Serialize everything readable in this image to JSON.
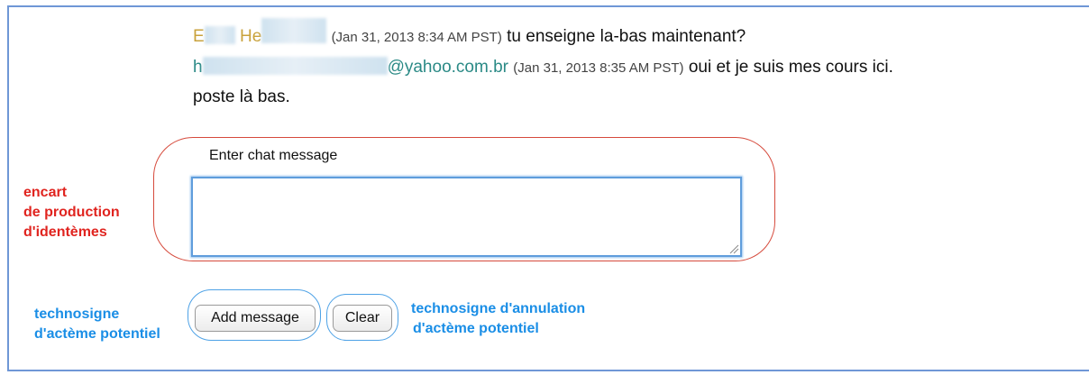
{
  "messages": [
    {
      "sender_visible_start": "E",
      "sender_visible_mid": "H",
      "sender_visible_end": "e",
      "timestamp": "(Jan 31, 2013 8:34 AM PST)",
      "text": "tu enseigne la-bas maintenant?"
    },
    {
      "sender_visible_start": "h",
      "sender_visible_end": "@yahoo.com.br",
      "timestamp": "(Jan 31, 2013 8:35 AM PST)",
      "text": "oui et je suis mes cours ici.",
      "text_continued": "poste là bas."
    }
  ],
  "chat_input": {
    "label": "Enter chat message",
    "value": ""
  },
  "buttons": {
    "add_label": "Add message",
    "clear_label": "Clear"
  },
  "annotations": {
    "red_line1": "encart",
    "red_line2": "de production",
    "red_line3": "d'identèmes",
    "blue_left_line1": "technosigne",
    "blue_left_line2": "d'actème potentiel",
    "blue_right_line1": "technosigne d'annulation",
    "blue_right_line2": "d'actème potentiel"
  },
  "colors": {
    "frame_border": "#6f97d6",
    "annotation_red": "#e0241f",
    "annotation_blue": "#1a8ee6",
    "sender_gold": "#c9a23c",
    "sender_teal": "#2b8a86"
  }
}
